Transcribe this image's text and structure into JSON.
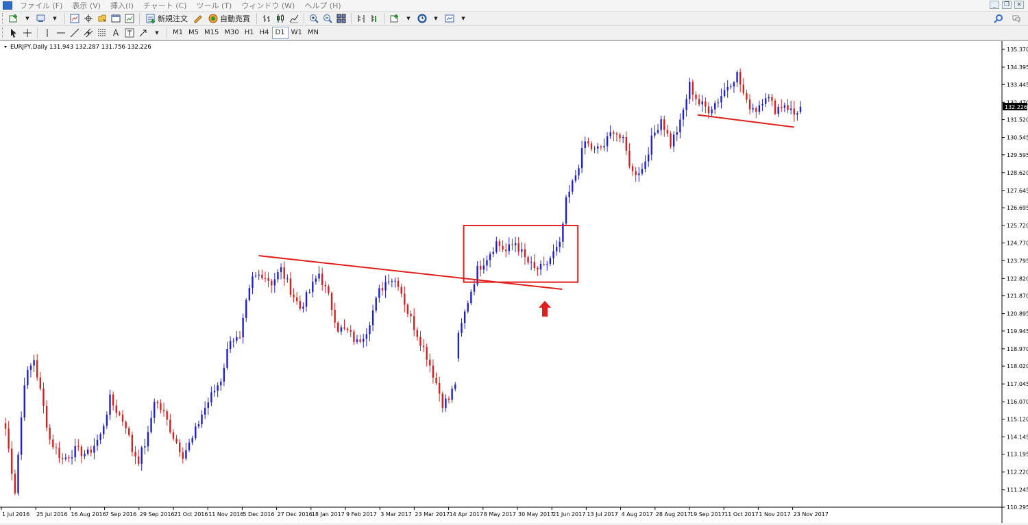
{
  "menu": {
    "items": [
      "ファイル (F)",
      "表示 (V)",
      "挿入(I)",
      "チャート (C)",
      "ツール (T)",
      "ウィンドウ (W)",
      "ヘルプ (H)"
    ]
  },
  "toolbar": {
    "new_order_label": "新規注文",
    "auto_trade_label": "自動売買",
    "timeframes": [
      "M1",
      "M5",
      "M15",
      "M30",
      "H1",
      "H4",
      "D1",
      "W1",
      "MN"
    ],
    "active_timeframe": "D1",
    "text_tool_label": "A"
  },
  "chart": {
    "header": "EURJPY,Daily  131.943 132.287 131.756 132.226",
    "current_price": "132.226",
    "colors": {
      "bull": "#1f1fcc",
      "bear": "#d32020",
      "annotation": "#e0201c",
      "axis": "#000000"
    }
  },
  "chart_data": {
    "type": "candlestick",
    "symbol": "EURJPY",
    "timeframe": "Daily",
    "ohlc_last": {
      "open": 131.943,
      "high": 132.287,
      "low": 131.756,
      "close": 132.226
    },
    "ylim": [
      110.295,
      135.37
    ],
    "y_ticks": [
      "135.370",
      "134.395",
      "133.445",
      "132.470",
      "131.520",
      "130.545",
      "129.595",
      "128.620",
      "127.645",
      "126.695",
      "125.720",
      "124.770",
      "123.795",
      "122.820",
      "121.870",
      "120.895",
      "119.945",
      "118.970",
      "118.020",
      "117.045",
      "116.070",
      "115.120",
      "114.145",
      "113.195",
      "112.220",
      "111.245",
      "110.295"
    ],
    "x_ticks": [
      "1 Jul 2016",
      "25 Jul 2016",
      "16 Aug 2016",
      "7 Sep 2016",
      "29 Sep 2016",
      "21 Oct 2016",
      "11 Nov 2016",
      "5 Dec 2016",
      "27 Dec 2016",
      "18 Jan 2017",
      "9 Feb 2017",
      "3 Mar 2017",
      "23 Mar 2017",
      "14 Apr 2017",
      "8 May 2017",
      "30 May 2017",
      "21 Jun 2017",
      "13 Jul 2017",
      "4 Aug 2017",
      "28 Aug 2017",
      "19 Sep 2017",
      "11 Oct 2017",
      "1 Nov 2017",
      "23 Nov 2017"
    ],
    "path": [
      [
        0,
        114.6
      ],
      [
        3,
        111.2
      ],
      [
        6,
        117.2
      ],
      [
        9,
        118.4
      ],
      [
        14,
        114.0
      ],
      [
        18,
        112.9
      ],
      [
        22,
        113.4
      ],
      [
        26,
        113.2
      ],
      [
        30,
        114.2
      ],
      [
        33,
        116.2
      ],
      [
        35,
        115.6
      ],
      [
        38,
        114.8
      ],
      [
        40,
        113.4
      ],
      [
        42,
        112.9
      ],
      [
        45,
        114.2
      ],
      [
        47,
        116.2
      ],
      [
        50,
        115.4
      ],
      [
        53,
        114.2
      ],
      [
        56,
        113.2
      ],
      [
        59,
        114.0
      ],
      [
        62,
        115.4
      ],
      [
        65,
        116.4
      ],
      [
        68,
        117.3
      ],
      [
        71,
        119.6
      ],
      [
        74,
        119.4
      ],
      [
        76,
        121.4
      ],
      [
        78,
        122.8
      ],
      [
        81,
        123.1
      ],
      [
        84,
        122.6
      ],
      [
        87,
        123.3
      ],
      [
        90,
        122.2
      ],
      [
        93,
        121.2
      ],
      [
        96,
        122.1
      ],
      [
        99,
        123.1
      ],
      [
        102,
        121.8
      ],
      [
        105,
        120.1
      ],
      [
        108,
        119.9
      ],
      [
        111,
        119.3
      ],
      [
        114,
        120.0
      ],
      [
        118,
        122.1
      ],
      [
        121,
        122.9
      ],
      [
        124,
        122.6
      ],
      [
        127,
        121.0
      ],
      [
        130,
        119.8
      ],
      [
        133,
        118.6
      ],
      [
        136,
        117.1
      ],
      [
        138,
        116.0
      ],
      [
        140,
        116.2
      ],
      [
        142,
        117.1
      ],
      [
        143,
        119.6
      ],
      [
        146,
        121.6
      ],
      [
        149,
        123.3
      ],
      [
        152,
        124.0
      ],
      [
        155,
        124.8
      ],
      [
        158,
        124.3
      ],
      [
        161,
        124.8
      ],
      [
        164,
        123.9
      ],
      [
        167,
        123.3
      ],
      [
        170,
        123.4
      ],
      [
        173,
        124.2
      ],
      [
        175,
        124.6
      ],
      [
        177,
        127.0
      ],
      [
        180,
        128.5
      ],
      [
        183,
        130.3
      ],
      [
        186,
        129.8
      ],
      [
        189,
        130.1
      ],
      [
        192,
        131.0
      ],
      [
        195,
        130.3
      ],
      [
        198,
        128.6
      ],
      [
        201,
        128.8
      ],
      [
        204,
        130.4
      ],
      [
        207,
        131.6
      ],
      [
        210,
        130.2
      ],
      [
        213,
        131.3
      ],
      [
        216,
        133.4
      ],
      [
        219,
        132.4
      ],
      [
        222,
        132.1
      ],
      [
        225,
        132.6
      ],
      [
        228,
        133.4
      ],
      [
        231,
        134.0
      ],
      [
        234,
        132.4
      ],
      [
        237,
        132.1
      ],
      [
        240,
        132.9
      ],
      [
        243,
        132.1
      ],
      [
        246,
        132.4
      ],
      [
        249,
        131.8
      ],
      [
        251,
        132.226
      ]
    ]
  },
  "annotations": {
    "rectangle": {
      "date_range": [
        "14 Apr 2017",
        "21 Jun 2017"
      ],
      "price_range": [
        122.62,
        125.72
      ]
    },
    "trendlines": [
      {
        "from": {
          "date": "5 Dec 2016",
          "price": 124.07
        },
        "to": {
          "date": "21 Jun 2017",
          "price": 122.23
        }
      },
      {
        "from": {
          "date": "19 Sep 2017",
          "price": 131.78
        },
        "to": {
          "date": "23 Nov 2017",
          "price": 131.11
        }
      }
    ],
    "arrow": {
      "date": "30 May 2017",
      "price": 121.6,
      "direction": "up"
    }
  }
}
